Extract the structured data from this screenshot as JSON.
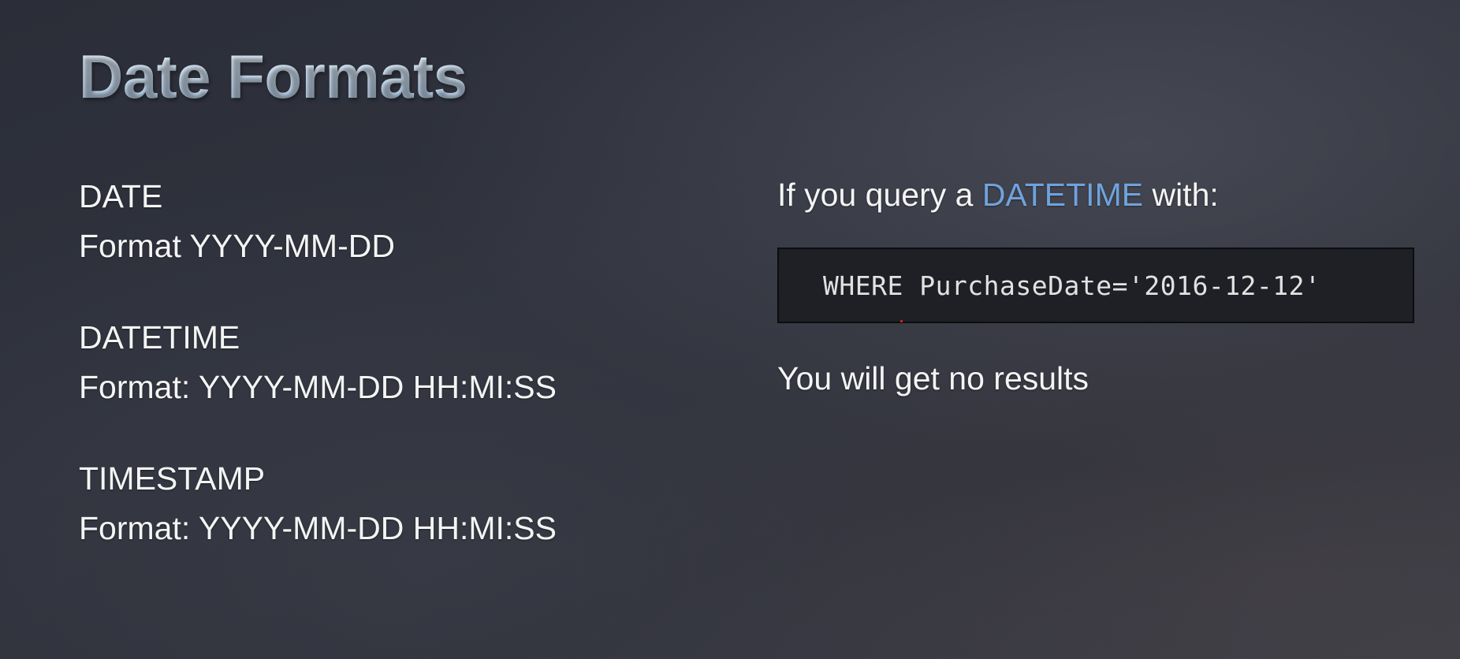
{
  "slide": {
    "title": "Date Formats"
  },
  "formats": [
    {
      "type": "DATE",
      "format": "Format YYYY-MM-DD"
    },
    {
      "type": "DATETIME",
      "format": "Format: YYYY-MM-DD HH:MI:SS"
    },
    {
      "type": "TIMESTAMP",
      "format": "Format: YYYY-MM-DD HH:MI:SS"
    }
  ],
  "query": {
    "prefix": "If you query a ",
    "keyword": "DATETIME",
    "suffix": " with:",
    "code": "WHERE PurchaseDate='2016-12-12'",
    "result": "You will get no results"
  },
  "colors": {
    "keyword_highlight": "#6fa3dc",
    "code_background": "#1f2025",
    "title_gradient_top": "#e6f0fb",
    "title_gradient_bottom": "#a9c4e0"
  }
}
